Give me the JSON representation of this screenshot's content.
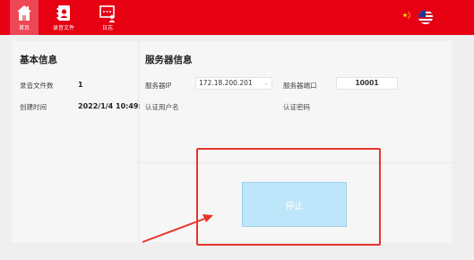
{
  "nav": {
    "items": [
      {
        "label": "首页",
        "icon": "home-icon"
      },
      {
        "label": "录音文件",
        "icon": "recording-files-icon"
      },
      {
        "label": "日志",
        "icon": "log-icon"
      }
    ],
    "languages": [
      "china-flag-icon",
      "us-flag-icon"
    ]
  },
  "colors": {
    "brand": "#e60012",
    "button": "#bee6fa",
    "annotation": "#e8352c"
  },
  "basic_info": {
    "title": "基本信息",
    "record_count_label": "录音文件数",
    "record_count_value": "1",
    "created_label": "创建时间",
    "created_value": "2022/1/4 10:49:"
  },
  "server_info": {
    "title": "服务器信息",
    "ip_label": "服务器IP",
    "ip_value": "172.18.200.201",
    "port_label": "服务器端口",
    "port_value": "10001",
    "username_label": "认证用户名",
    "password_label": "认证密码"
  },
  "action": {
    "stop_label": "停止"
  }
}
